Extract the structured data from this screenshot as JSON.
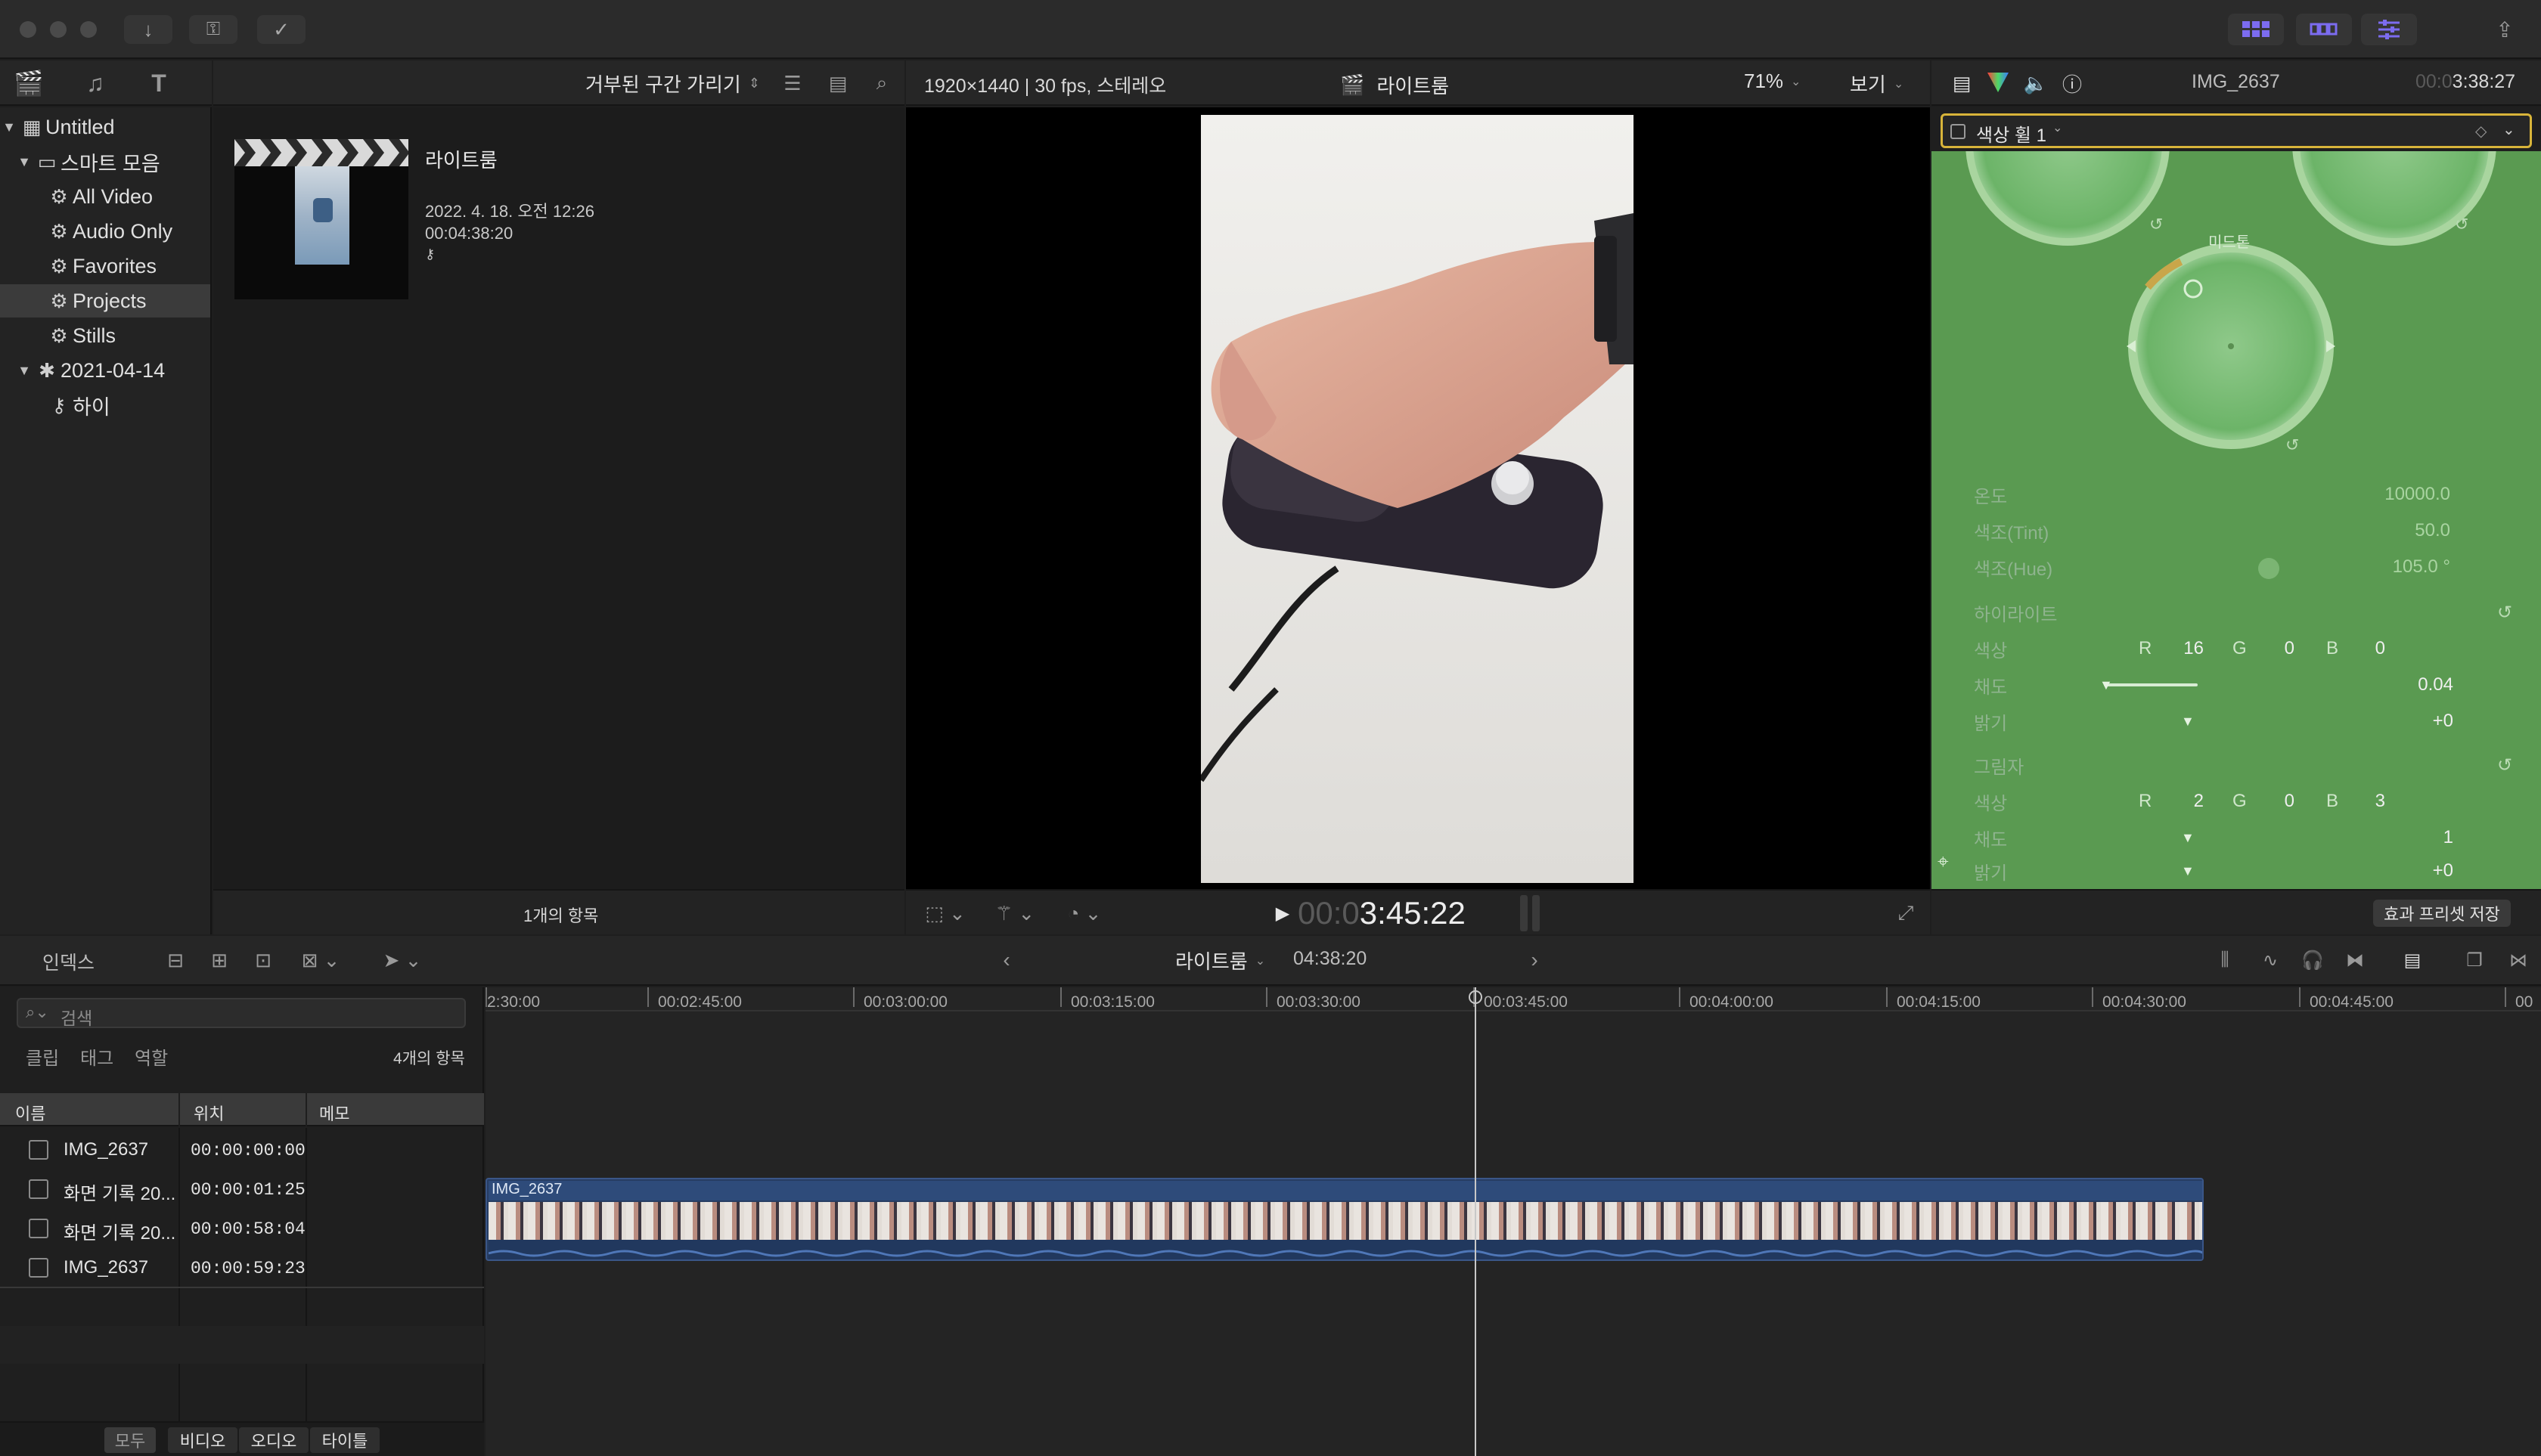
{
  "library": {
    "title": "Untitled",
    "smart_collection_folder": "스마트 모음",
    "items": [
      "All Video",
      "Audio Only",
      "Favorites",
      "Projects",
      "Stills"
    ],
    "event": "2021-04-14",
    "event_item": "하이"
  },
  "browser": {
    "filter": "거부된 구간 가리기",
    "project": {
      "name": "라이트룸",
      "date": "2022. 4. 18. 오전 12:26",
      "duration": "00:04:38:20"
    },
    "footer_count": "1개의 항목"
  },
  "viewer": {
    "format": "1920×1440 | 30 fps, 스테레오",
    "title": "라이트룸",
    "zoom": "71%",
    "view_menu": "보기",
    "timecode_dim": "00:0",
    "timecode": "3:45:22"
  },
  "inspector": {
    "clip_name": "IMG_2637",
    "timecode_dim": "00:0",
    "timecode": "3:38:27",
    "effect_name": "색상 휠 1",
    "wheel_label": "미드톤",
    "params": [
      {
        "label": "온도",
        "value": "10000.0"
      },
      {
        "label": "색조(Tint)",
        "value": "50.0"
      },
      {
        "label": "색조(Hue)",
        "value": "105.0 °"
      }
    ],
    "highlights": {
      "section": "하이라이트",
      "color_label": "색상",
      "r": "16",
      "g": "0",
      "b": "0",
      "sat_label": "채도",
      "sat": "0.04",
      "bright_label": "밝기",
      "bright": "+0"
    },
    "shadows": {
      "section": "그림자",
      "color_label": "색상",
      "r": "2",
      "g": "0",
      "b": "3",
      "sat_label": "채도",
      "sat": "1",
      "bright_label": "밝기",
      "bright": "+0"
    },
    "rgb": {
      "r": "R",
      "g": "G",
      "b": "B"
    },
    "save_preset": "효과 프리셋 저장",
    "accent_green": "#5fa355"
  },
  "timeline_bar": {
    "index_label": "인덱스",
    "project": "라이트룸",
    "duration": "04:38:20"
  },
  "index": {
    "search_placeholder": "검색",
    "tabs": [
      "클립",
      "태그",
      "역할"
    ],
    "count": "4개의 항목",
    "columns": [
      "이름",
      "위치",
      "메모"
    ],
    "rows": [
      {
        "name": "IMG_2637",
        "pos": "00:00:00:00"
      },
      {
        "name": "화면 기록 20...",
        "pos": "00:00:01:25"
      },
      {
        "name": "화면 기록 20...",
        "pos": "00:00:58:04"
      },
      {
        "name": "IMG_2637",
        "pos": "00:00:59:23"
      }
    ],
    "filters": [
      "모두",
      "비디오",
      "오디오",
      "타이틀"
    ]
  },
  "timeline": {
    "ruler": [
      "2:30:00",
      "00:02:45:00",
      "00:03:00:00",
      "00:03:15:00",
      "00:03:30:00",
      "00:03:45:00",
      "00:04:00:00",
      "00:04:15:00",
      "00:04:30:00",
      "00:04:45:00",
      "00"
    ],
    "clip_name": "IMG_2637"
  }
}
